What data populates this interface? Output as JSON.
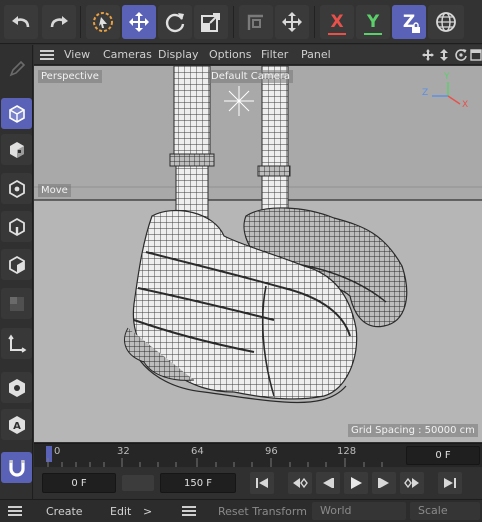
{
  "viewport_menu": {
    "items": [
      "View",
      "Cameras",
      "Display",
      "Options",
      "Filter",
      "Panel"
    ]
  },
  "viewport": {
    "camera_label": "Perspective",
    "default_camera_label": "Default Camera",
    "tool_label": "Move",
    "grid_spacing": "Grid Spacing : 50000 cm",
    "axis_labels": {
      "x": "X",
      "y": "Y",
      "z": "Z"
    }
  },
  "toolbar": {
    "axis_x": "X",
    "axis_y": "Y",
    "axis_z": "Z",
    "colors": {
      "x": "#e8504a",
      "y": "#5bd06a",
      "z": "#5b8ee8",
      "active": "#5a62b8"
    }
  },
  "timeline": {
    "ticks": [
      "0",
      "32",
      "64",
      "96",
      "128"
    ],
    "current_frame_display": "0 F"
  },
  "transport": {
    "start_frame": "0 F",
    "end_frame": "150 F"
  },
  "bottombar": {
    "create": "Create",
    "edit": "Edit",
    "more": ">",
    "reset_transform": "Reset Transform",
    "coord_mode": "World",
    "transform_mode": "Scale"
  }
}
